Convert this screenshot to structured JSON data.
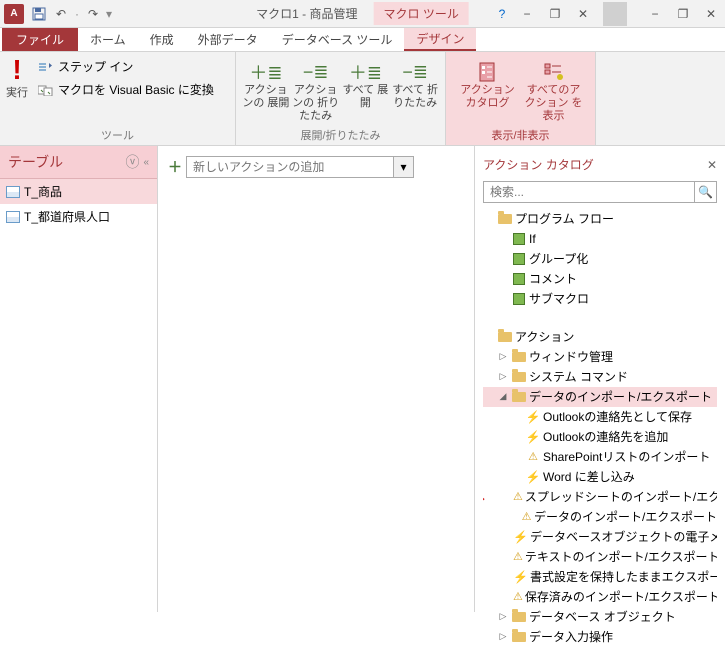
{
  "title": {
    "app_icon": "A",
    "doc": "マクロ1 - 商品管理",
    "context_tab_group": "マクロ ツール"
  },
  "qat": {
    "save": "💾",
    "undo": "↶",
    "redo": "↷"
  },
  "win": {
    "help": "?",
    "min": "−",
    "restore": "❐",
    "close": "✕"
  },
  "tabs": {
    "file": "ファイル",
    "home": "ホーム",
    "create": "作成",
    "external": "外部データ",
    "dbtools": "データベース ツール",
    "design": "デザイン"
  },
  "ribbon": {
    "tools": {
      "exec": "実行",
      "step_in": "ステップ イン",
      "convert_vb": "マクロを Visual Basic に変換",
      "label": "ツール"
    },
    "expand": {
      "expand_actions": "アクションの\n展開",
      "collapse_actions": "アクションの\n折りたたみ",
      "expand_all": "すべて\n展開",
      "collapse_all": "すべて\n折りたたみ",
      "label": "展開/折りたたみ"
    },
    "show": {
      "catalog": "アクション\nカタログ",
      "show_all": "すべてのアクション\nを表示",
      "label": "表示/非表示"
    }
  },
  "nav": {
    "header": "テーブル",
    "items": [
      "T_商品",
      "T_都道府県人口"
    ]
  },
  "design": {
    "add_placeholder": "新しいアクションの追加"
  },
  "catalog": {
    "title": "アクション カタログ",
    "search_placeholder": "検索...",
    "program_flow": {
      "label": "プログラム フロー",
      "items": [
        "If",
        "グループ化",
        "コメント",
        "サブマクロ"
      ]
    },
    "actions": {
      "label": "アクション",
      "cats": [
        {
          "label": "ウィンドウ管理",
          "expanded": false
        },
        {
          "label": "システム コマンド",
          "expanded": false
        },
        {
          "label": "データのインポート/エクスポート",
          "expanded": true,
          "selected": true,
          "items": [
            {
              "label": "Outlookの連絡先として保存",
              "t": "lit"
            },
            {
              "label": "Outlookの連絡先を追加",
              "t": "lit"
            },
            {
              "label": "SharePointリストのインポート",
              "t": "warn"
            },
            {
              "label": "Word に差し込み",
              "t": "lit"
            },
            {
              "label": "スプレッドシートのインポート/エクスポート",
              "t": "warn",
              "arrow": true
            },
            {
              "label": "データのインポート/エクスポート",
              "t": "warn"
            },
            {
              "label": "データベースオブジェクトの電子メール送",
              "t": "lit"
            },
            {
              "label": "テキストのインポート/エクスポート",
              "t": "warn"
            },
            {
              "label": "書式設定を保持したままエクスポート",
              "t": "lit"
            },
            {
              "label": "保存済みのインポート/エクスポート操作",
              "t": "warn"
            }
          ]
        },
        {
          "label": "データベース オブジェクト",
          "expanded": false
        },
        {
          "label": "データ入力操作",
          "expanded": false
        }
      ]
    }
  }
}
